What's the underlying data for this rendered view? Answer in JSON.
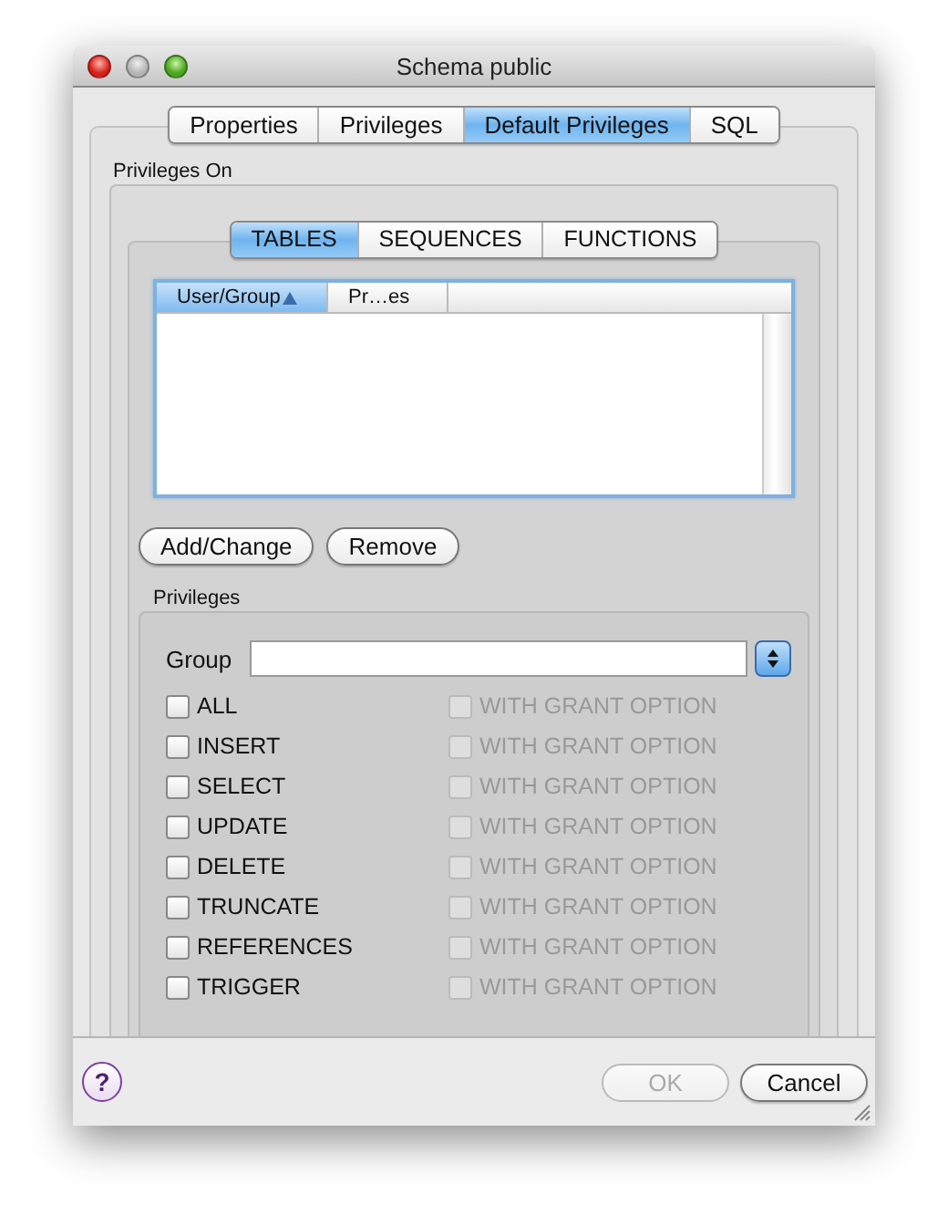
{
  "window": {
    "title": "Schema public"
  },
  "tabs": [
    {
      "label": "Properties",
      "selected": false
    },
    {
      "label": "Privileges",
      "selected": false
    },
    {
      "label": "Default Privileges",
      "selected": true
    },
    {
      "label": "SQL",
      "selected": false
    }
  ],
  "privileges_on": {
    "label": "Privileges On",
    "tabs": [
      {
        "label": "TABLES",
        "selected": true
      },
      {
        "label": "SEQUENCES",
        "selected": false
      },
      {
        "label": "FUNCTIONS",
        "selected": false
      }
    ],
    "table": {
      "columns": [
        {
          "label": "User/Group",
          "sorted": true
        },
        {
          "label": "Pr…es",
          "sorted": false
        }
      ]
    },
    "buttons": [
      "Add/Change",
      "Remove"
    ],
    "privileges": {
      "label": "Privileges",
      "group": {
        "label": "Group"
      },
      "rows": [
        {
          "label": "ALL",
          "checked": false,
          "grant": {
            "label": "WITH GRANT OPTION",
            "checked": false,
            "disabled": true
          }
        },
        {
          "label": "INSERT",
          "checked": false,
          "grant": {
            "label": "WITH GRANT OPTION",
            "checked": false,
            "disabled": true
          }
        },
        {
          "label": "SELECT",
          "checked": false,
          "grant": {
            "label": "WITH GRANT OPTION",
            "checked": false,
            "disabled": true
          }
        },
        {
          "label": "UPDATE",
          "checked": false,
          "grant": {
            "label": "WITH GRANT OPTION",
            "checked": false,
            "disabled": true
          }
        },
        {
          "label": "DELETE",
          "checked": false,
          "grant": {
            "label": "WITH GRANT OPTION",
            "checked": false,
            "disabled": true
          }
        },
        {
          "label": "TRUNCATE",
          "checked": false,
          "grant": {
            "label": "WITH GRANT OPTION",
            "checked": false,
            "disabled": true
          }
        },
        {
          "label": "REFERENCES",
          "checked": false,
          "grant": {
            "label": "WITH GRANT OPTION",
            "checked": false,
            "disabled": true
          }
        },
        {
          "label": "TRIGGER",
          "checked": false,
          "grant": {
            "label": "WITH GRANT OPTION",
            "checked": false,
            "disabled": true
          }
        }
      ]
    }
  },
  "help_button": "?",
  "buttons": [
    {
      "label": "OK",
      "disabled": true
    },
    {
      "label": "Cancel",
      "disabled": false
    }
  ]
}
